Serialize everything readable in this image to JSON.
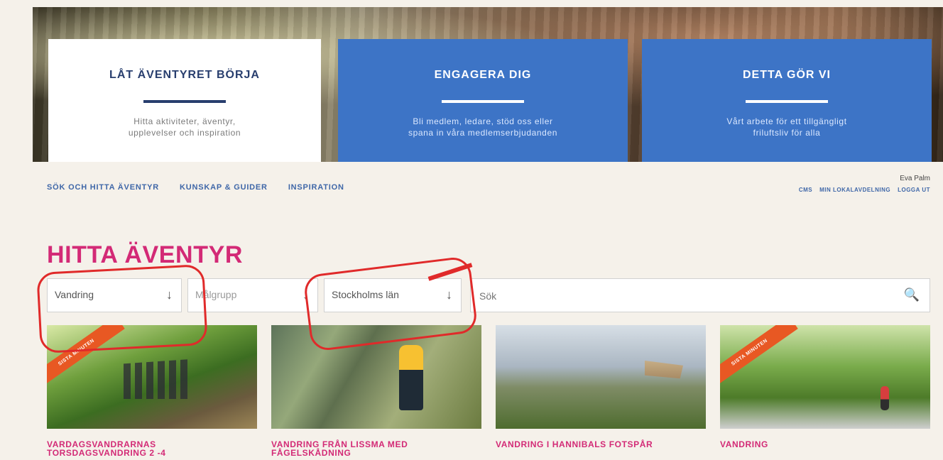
{
  "hero": {
    "panels": [
      {
        "title": "LÅT ÄVENTYRET BÖRJA",
        "desc_lines": [
          "Hitta aktiviteter, äventyr,",
          "upplevelser och inspiration"
        ]
      },
      {
        "title": "ENGAGERA DIG",
        "desc_lines": [
          "Bli medlem, ledare, stöd oss eller",
          "spana in våra medlemserbjudanden"
        ]
      },
      {
        "title": "DETTA GÖR VI",
        "desc_lines": [
          "Vårt arbete för ett tillgängligt",
          "friluftsliv för alla"
        ]
      }
    ]
  },
  "nav": {
    "items": [
      "SÖK OCH HITTA ÄVENTYR",
      "KUNSKAP & GUIDER",
      "INSPIRATION"
    ],
    "user_name": "Eva Palm",
    "user_links": [
      "CMS",
      "MIN LOKALAVDELNING",
      "LOGGA UT"
    ]
  },
  "section": {
    "title": "HITTA ÄVENTYR"
  },
  "filters": {
    "activity": "Vandring",
    "target_group": "Målgrupp",
    "region": "Stockholms län",
    "search_placeholder": "Sök"
  },
  "cards": [
    {
      "title_lines": [
        "VARDAGSVANDRARNAS",
        "TORSDAGSVANDRING 2 -4"
      ],
      "badge": "SISTA MINUTEN"
    },
    {
      "title_lines": [
        "VANDRING FRÅN LISSMA MED",
        "FÅGELSKÅDNING"
      ],
      "badge": ""
    },
    {
      "title_lines": [
        "VANDRING I HANNIBALS FOTSPÅR"
      ],
      "badge": ""
    },
    {
      "title_lines": [
        "VANDRING"
      ],
      "badge": "SISTA MINUTEN"
    }
  ],
  "colors": {
    "brand_blue": "#3d74c6",
    "brand_pink": "#d32a76",
    "annotation_red": "#e02a2a",
    "ribbon_orange": "#e85823"
  },
  "icons": {
    "dropdown": "arrow-down-icon",
    "search": "search-icon"
  }
}
